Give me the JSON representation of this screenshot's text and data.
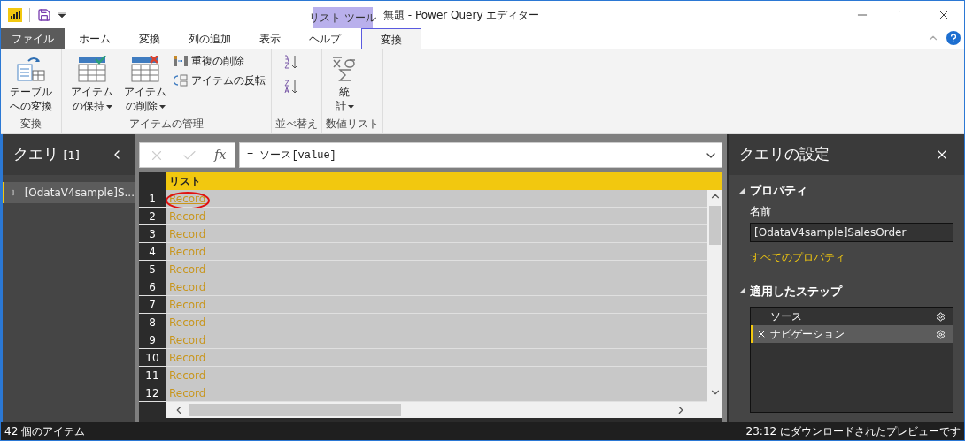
{
  "window": {
    "title": "無題 - Power Query エディター",
    "context_tab_group": "リスト ツール"
  },
  "tabs": [
    {
      "label": "ファイル",
      "kind": "file",
      "selected": false
    },
    {
      "label": "ホーム",
      "kind": "tab",
      "selected": false
    },
    {
      "label": "変換",
      "kind": "tab",
      "selected": false
    },
    {
      "label": "列の追加",
      "kind": "tab",
      "selected": false
    },
    {
      "label": "表示",
      "kind": "tab",
      "selected": false
    },
    {
      "label": "ヘルプ",
      "kind": "tab",
      "selected": false
    },
    {
      "label": "変換",
      "kind": "context",
      "selected": true
    }
  ],
  "ribbon": [
    {
      "label": "変換",
      "items": [
        {
          "kind": "convert",
          "lines": [
            "テーブル",
            "への変換"
          ],
          "dropdown": false
        }
      ]
    },
    {
      "label": "アイテムの管理",
      "items": [
        {
          "kind": "keep",
          "lines": [
            "アイテム",
            "の保持"
          ],
          "dropdown": true
        },
        {
          "kind": "remove",
          "lines": [
            "アイテム",
            "の削除"
          ],
          "dropdown": true
        },
        {
          "kind": "stack",
          "entries": [
            "重複の削除",
            "アイテムの反転"
          ]
        }
      ]
    },
    {
      "label": "並べ替え",
      "items": [
        {
          "kind": "sort"
        }
      ]
    },
    {
      "label": "数値リスト",
      "items": [
        {
          "kind": "stats",
          "lines": [
            "統",
            "計"
          ],
          "dropdown": true
        }
      ]
    }
  ],
  "queries_pane": {
    "title": "クエリ",
    "count": "[1]",
    "items": [
      {
        "label": "[OdataV4sample]S...",
        "selected": true
      }
    ]
  },
  "formula_bar": {
    "function_label": "fx",
    "value": "= ソース[value]"
  },
  "grid": {
    "header": "リスト",
    "rows": [
      {
        "n": "1",
        "value": "Record",
        "circled": true
      },
      {
        "n": "2",
        "value": "Record",
        "circled": false
      },
      {
        "n": "3",
        "value": "Record",
        "circled": false
      },
      {
        "n": "4",
        "value": "Record",
        "circled": false
      },
      {
        "n": "5",
        "value": "Record",
        "circled": false
      },
      {
        "n": "6",
        "value": "Record",
        "circled": false
      },
      {
        "n": "7",
        "value": "Record",
        "circled": false
      },
      {
        "n": "8",
        "value": "Record",
        "circled": false
      },
      {
        "n": "9",
        "value": "Record",
        "circled": false
      },
      {
        "n": "10",
        "value": "Record",
        "circled": false
      },
      {
        "n": "11",
        "value": "Record",
        "circled": false
      },
      {
        "n": "12",
        "value": "Record",
        "circled": false
      }
    ]
  },
  "settings_pane": {
    "title": "クエリの設定",
    "properties_heading": "プロパティ",
    "name_label": "名前",
    "name_value": "[OdataV4sample]SalesOrder",
    "all_properties_link": "すべてのプロパティ",
    "steps_heading": "適用したステップ",
    "steps": [
      {
        "label": "ソース",
        "deletable": false,
        "selected": false
      },
      {
        "label": "ナビゲーション",
        "deletable": true,
        "selected": true
      }
    ]
  },
  "status_bar": {
    "left": "42 個のアイテム",
    "right": "23:12 にダウンロードされたプレビューです"
  }
}
